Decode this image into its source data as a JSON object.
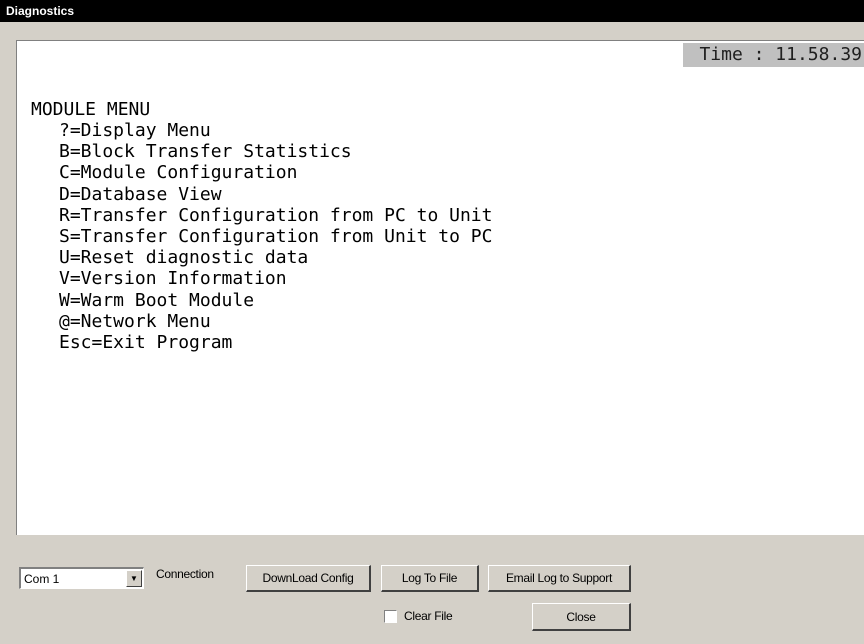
{
  "window": {
    "title": "Diagnostics"
  },
  "console": {
    "time_text": "Time : 11.58.39",
    "menu_title": "MODULE MENU",
    "menu_items": [
      "?=Display Menu",
      "B=Block Transfer Statistics",
      "C=Module Configuration",
      "D=Database View",
      "R=Transfer Configuration from PC to Unit",
      "S=Transfer Configuration from Unit to PC",
      "U=Reset diagnostic data",
      "V=Version Information",
      "W=Warm Boot Module",
      "@=Network Menu",
      "Esc=Exit Program"
    ]
  },
  "controls": {
    "com_port_value": "Com 1",
    "connection_label": "Connection",
    "download_config_label": "DownLoad Config",
    "log_to_file_label": "Log To File",
    "email_log_label": "Email Log to Support",
    "clear_file_label": "Clear File",
    "clear_file_checked": false,
    "close_label": "Close"
  }
}
